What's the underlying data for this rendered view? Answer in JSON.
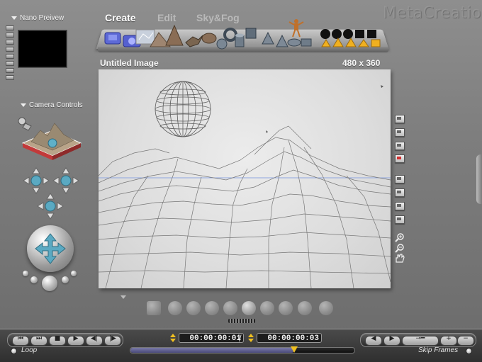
{
  "app": {
    "brand": "MetaCreations"
  },
  "left_panel": {
    "nano_preview_label": "Nano Preivew",
    "camera_controls_label": "Camera Controls"
  },
  "tabs": [
    {
      "label": "Create",
      "active": true
    },
    {
      "label": "Edit",
      "active": false
    },
    {
      "label": "Sky&Fog",
      "active": false
    }
  ],
  "shelf_icons": [
    "square-terrain-icon",
    "square-terrain-icon",
    "glass-terrain-icon",
    "rock-terrain-icon",
    "cone-terrain-icon",
    "star-object-icon",
    "rock-object-icon",
    "sphere-icon",
    "torus-icon",
    "cylinder-icon",
    "cube-icon",
    "pyramid-icon",
    "cone-icon",
    "disc-icon",
    "plane-icon",
    "figure-icon",
    "black-sphere-icon",
    "black-sphere-icon",
    "black-sphere-icon",
    "black-cube-icon",
    "black-square-icon",
    "gold-cone-icon",
    "gold-cone-icon",
    "gold-cone-icon",
    "gold-cube-icon"
  ],
  "document": {
    "title": "Untitled Image",
    "size": "480 x 360"
  },
  "timeline": {
    "loop_label": "Loop",
    "skip_frames_label": "Skip Frames",
    "timecode_current": "00:00:00:01",
    "timecode_end": "00:00:00:03",
    "separator": "/",
    "playhead_fraction": 0.73
  },
  "colors": {
    "accent": "#4a4a7a",
    "playhead": "#f0c020",
    "horizon_line": "#8ea6e0",
    "red_tool": "#d23030"
  }
}
